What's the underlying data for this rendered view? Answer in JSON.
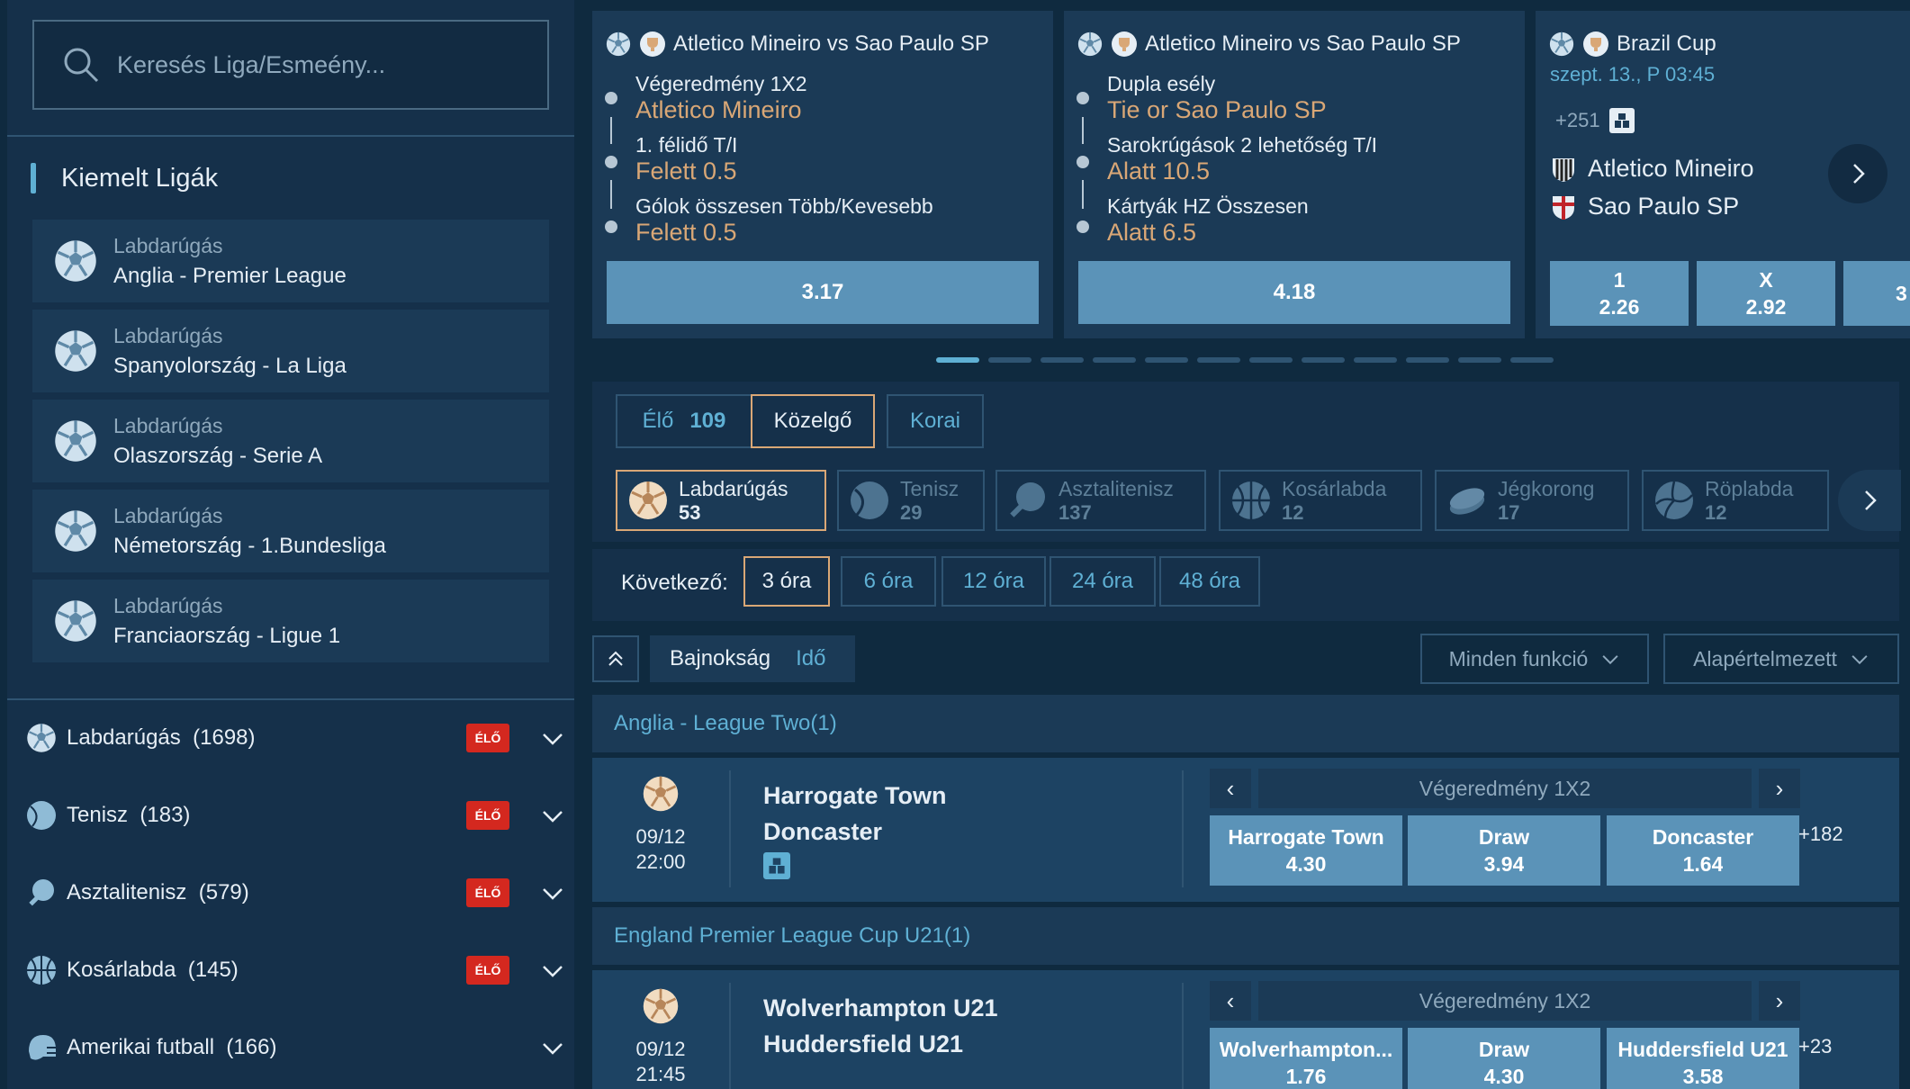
{
  "search": {
    "placeholder": "Keresés Liga/Esmeény..."
  },
  "featured": {
    "title": "Kiemelt Ligák",
    "items": [
      {
        "sport": "Labdarúgás",
        "name": "Anglia - Premier League"
      },
      {
        "sport": "Labdarúgás",
        "name": "Spanyolország - La Liga"
      },
      {
        "sport": "Labdarúgás",
        "name": "Olaszország - Serie A"
      },
      {
        "sport": "Labdarúgás",
        "name": "Németország - 1.Bundesliga"
      },
      {
        "sport": "Labdarúgás",
        "name": "Franciaország - Ligue 1"
      }
    ]
  },
  "sports_list": [
    {
      "name": "Labdarúgás",
      "count": "(1698)",
      "live": "ÉLŐ",
      "icon": "soccer-ball-icon"
    },
    {
      "name": "Tenisz",
      "count": "(183)",
      "live": "ÉLŐ",
      "icon": "tennis-ball-icon"
    },
    {
      "name": "Asztalitenisz",
      "count": "(579)",
      "live": "ÉLŐ",
      "icon": "table-tennis-icon"
    },
    {
      "name": "Kosárlabda",
      "count": "(145)",
      "live": "ÉLŐ",
      "icon": "basketball-icon"
    },
    {
      "name": "Amerikai futball",
      "count": "(166)",
      "live": "",
      "icon": "american-football-helmet-icon"
    }
  ],
  "cards": [
    {
      "title": "Atletico Mineiro vs Sao Paulo SP",
      "legs": [
        {
          "market": "Végeredmény 1X2",
          "pick": "Atletico Mineiro"
        },
        {
          "market": "1. félidő T/I",
          "pick": "Felett 0.5"
        },
        {
          "market": "Gólok összesen Több/Kevesebb",
          "pick": "Felett 0.5"
        }
      ],
      "odds": "3.17"
    },
    {
      "title": "Atletico Mineiro vs Sao Paulo SP",
      "legs": [
        {
          "market": "Dupla esély",
          "pick": "Tie or Sao Paulo SP"
        },
        {
          "market": "Sarokrúgások 2 lehetőség T/I",
          "pick": "Alatt 10.5"
        },
        {
          "market": "Kártyák HZ Összesen",
          "pick": "Alatt 6.5"
        }
      ],
      "odds": "4.18"
    },
    {
      "title": "Brazil Cup",
      "date": "szept. 13., P 03:45",
      "more": "+251",
      "home": "Atletico Mineiro",
      "away": "Sao Paulo SP",
      "odds": [
        {
          "label": "1",
          "value": "2.26"
        },
        {
          "label": "X",
          "value": "2.92"
        },
        {
          "label": "",
          "value": "3"
        }
      ]
    }
  ],
  "state_tabs": [
    {
      "label": "Élő",
      "count": "109"
    },
    {
      "label": "Közelgő",
      "count": ""
    },
    {
      "label": "Korai",
      "count": ""
    }
  ],
  "sport_tabs": [
    {
      "label": "Labdarúgás",
      "count": "53",
      "icon": "soccer-ball-icon"
    },
    {
      "label": "Tenisz",
      "count": "29",
      "icon": "tennis-ball-icon"
    },
    {
      "label": "Asztalitenisz",
      "count": "137",
      "icon": "table-tennis-icon"
    },
    {
      "label": "Kosárlabda",
      "count": "12",
      "icon": "basketball-icon"
    },
    {
      "label": "Jégkorong",
      "count": "17",
      "icon": "hockey-puck-icon"
    },
    {
      "label": "Röplabda",
      "count": "12",
      "icon": "volleyball-icon"
    }
  ],
  "time_filter": {
    "label": "Következő:",
    "options": [
      "3 óra",
      "6 óra",
      "12 óra",
      "24 óra",
      "48 óra"
    ]
  },
  "sort": {
    "league": "Bajnokság",
    "time": "Idő",
    "functions": "Minden funkció",
    "default": "Alapértelmezett"
  },
  "leagues": [
    {
      "name": "Anglia - League Two(1)",
      "match": {
        "date": "09/12",
        "time": "22:00",
        "home": "Harrogate Town",
        "away": "Doncaster",
        "market": "Végeredmény 1X2",
        "odds": [
          {
            "label": "Harrogate Town",
            "value": "4.30"
          },
          {
            "label": "Draw",
            "value": "3.94"
          },
          {
            "label": "Doncaster",
            "value": "1.64"
          }
        ],
        "more": "+182"
      }
    },
    {
      "name": "England Premier League Cup U21(1)",
      "match": {
        "date": "09/12",
        "time": "21:45",
        "home": "Wolverhampton U21",
        "away": "Huddersfield U21",
        "market": "Végeredmény 1X2",
        "odds": [
          {
            "label": "Wolverhampton...",
            "value": "1.76"
          },
          {
            "label": "Draw",
            "value": "4.30"
          },
          {
            "label": "Huddersfield U21",
            "value": "3.58"
          }
        ],
        "more": "+23"
      }
    }
  ]
}
